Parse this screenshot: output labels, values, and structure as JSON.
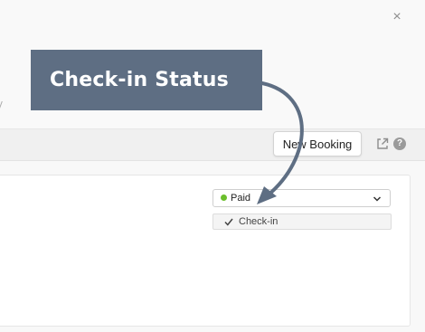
{
  "modal": {
    "close_icon": "close-icon",
    "close_glyph": "×"
  },
  "toolbar": {
    "new_booking_label": "New Booking",
    "external_icon": "external-link-icon",
    "help_icon": "help-icon",
    "help_glyph": "?"
  },
  "status_dropdown": {
    "selected": "Paid",
    "selected_color": "#6bbf2c",
    "options": [
      {
        "label": "Check-in",
        "checked": true
      }
    ]
  },
  "annotation": {
    "callout_text": "Check-in Status",
    "callout_color": "#5e6e83"
  }
}
